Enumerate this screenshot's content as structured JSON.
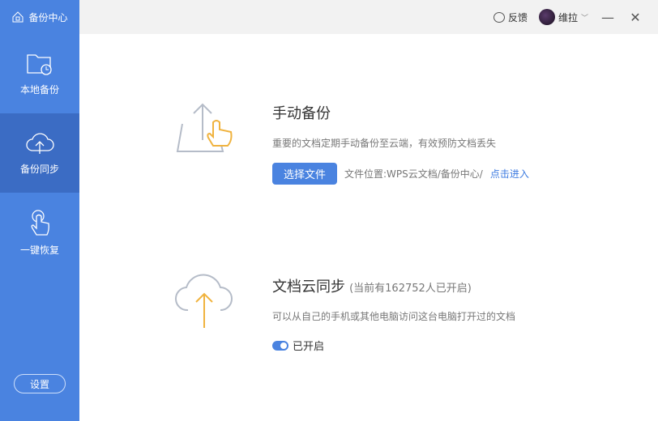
{
  "sidebar": {
    "brand": "备份中心",
    "items": [
      {
        "label": "本地备份"
      },
      {
        "label": "备份同步"
      },
      {
        "label": "一键恢复"
      }
    ],
    "settings": "设置"
  },
  "topbar": {
    "feedback": "反馈",
    "user": "维拉"
  },
  "manual": {
    "title": "手动备份",
    "desc": "重要的文档定期手动备份至云端，有效预防文档丢失",
    "button": "选择文件",
    "location": "文件位置:WPS云文档/备份中心/",
    "link": "点击进入"
  },
  "cloud": {
    "title": "文档云同步",
    "count": "(当前有162752人已开启)",
    "desc": "可以从自己的手机或其他电脑访问这台电脑打开过的文档",
    "status": "已开启"
  },
  "colors": {
    "accent": "#4a83e0",
    "icon_orange": "#f0b33f"
  }
}
